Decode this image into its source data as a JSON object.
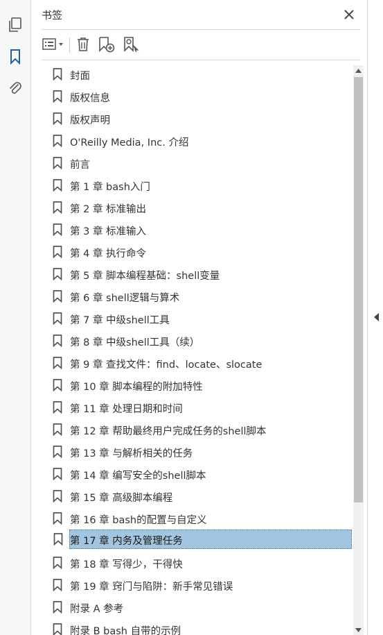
{
  "panel": {
    "title": "书签"
  },
  "sidebar": {
    "items": [
      {
        "icon": "pages-icon"
      },
      {
        "icon": "bookmark-icon",
        "active": true
      },
      {
        "icon": "attachment-icon"
      }
    ]
  },
  "toolbar": {
    "options_icon": "list-options-icon",
    "delete_icon": "trash-icon",
    "new_bookmark_icon": "new-bookmark-icon",
    "find_bookmark_icon": "find-current-bookmark-icon"
  },
  "bookmarks": [
    {
      "label": "封面"
    },
    {
      "label": "版权信息"
    },
    {
      "label": "版权声明"
    },
    {
      "label": "O'Reilly Media, Inc. 介绍"
    },
    {
      "label": "前言"
    },
    {
      "label": "第 1 章 bash入门"
    },
    {
      "label": "第 2 章 标准输出"
    },
    {
      "label": "第 3 章 标准输入"
    },
    {
      "label": "第 4 章 执行命令"
    },
    {
      "label": "第 5 章 脚本编程基础：shell变量"
    },
    {
      "label": "第 6 章 shell逻辑与算术"
    },
    {
      "label": "第 7 章 中级shell工具"
    },
    {
      "label": "第 8 章 中级shell工具（续）"
    },
    {
      "label": "第 9 章 查找文件：find、locate、slocate"
    },
    {
      "label": "第 10 章 脚本编程的附加特性"
    },
    {
      "label": "第 11 章 处理日期和时间"
    },
    {
      "label": "第 12 章 帮助最终用户完成任务的shell脚本"
    },
    {
      "label": "第 13 章 与解析相关的任务"
    },
    {
      "label": "第 14 章 编写安全的shell脚本"
    },
    {
      "label": "第 15 章 高级脚本编程"
    },
    {
      "label": "第 16 章 bash的配置与自定义"
    },
    {
      "label": "第 17 章 内务及管理任务",
      "selected": true
    },
    {
      "label": "第 18 章 写得少，干得快"
    },
    {
      "label": "第 19 章 窍门与陷阱：新手常见错误"
    },
    {
      "label": "附录 A 参考"
    },
    {
      "label": "附录 B bash 自带的示例"
    }
  ],
  "colors": {
    "accent": "#1f5fa8",
    "selected_bg": "#a3c6e0"
  }
}
